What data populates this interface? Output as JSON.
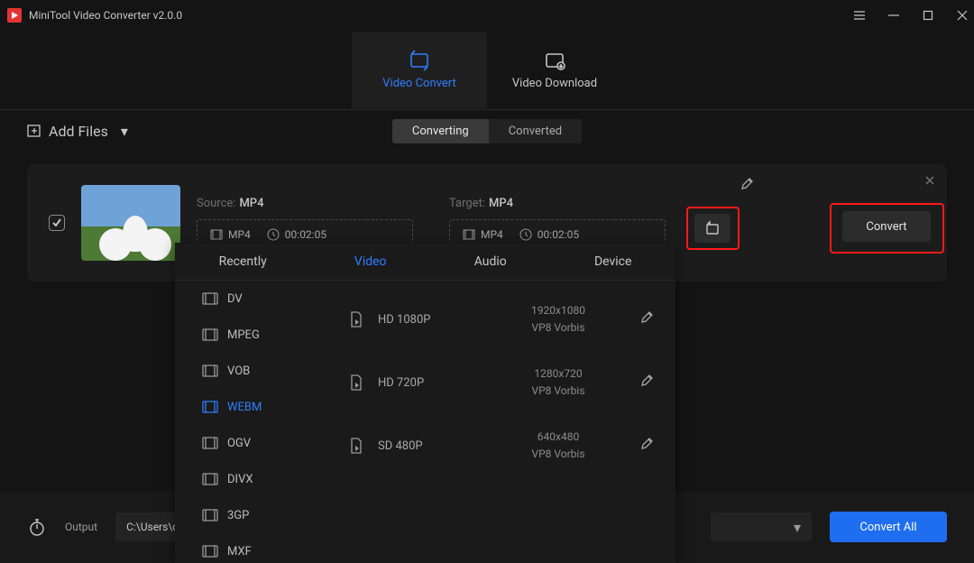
{
  "app": {
    "title": "MiniTool Video Converter v2.0.0"
  },
  "mode_tabs": {
    "video_convert": "Video Convert",
    "video_download": "Video Download"
  },
  "subbar": {
    "add_files": "Add Files",
    "converting": "Converting",
    "converted": "Converted"
  },
  "task": {
    "source_label": "Source:",
    "source_fmt": "MP4",
    "target_label": "Target:",
    "target_fmt": "MP4",
    "src_box_fmt": "MP4",
    "src_box_time": "00:02:05",
    "tgt_box_fmt": "MP4",
    "tgt_box_time": "00:02:05",
    "convert": "Convert"
  },
  "popup": {
    "tabs": {
      "recently": "Recently",
      "video": "Video",
      "audio": "Audio",
      "device": "Device"
    },
    "formats": [
      "DV",
      "MPEG",
      "VOB",
      "WEBM",
      "OGV",
      "DIVX",
      "3GP",
      "MXF"
    ],
    "active_format": "WEBM",
    "profiles": [
      {
        "name": "HD 1080P",
        "res": "1920x1080",
        "codec": "VP8  Vorbis"
      },
      {
        "name": "HD 720P",
        "res": "1280x720",
        "codec": "VP8  Vorbis"
      },
      {
        "name": "SD 480P",
        "res": "640x480",
        "codec": "VP8  Vorbis"
      }
    ]
  },
  "bottom": {
    "output_label": "Output",
    "output_path": "C:\\Users\\c",
    "convert_all": "Convert All"
  }
}
